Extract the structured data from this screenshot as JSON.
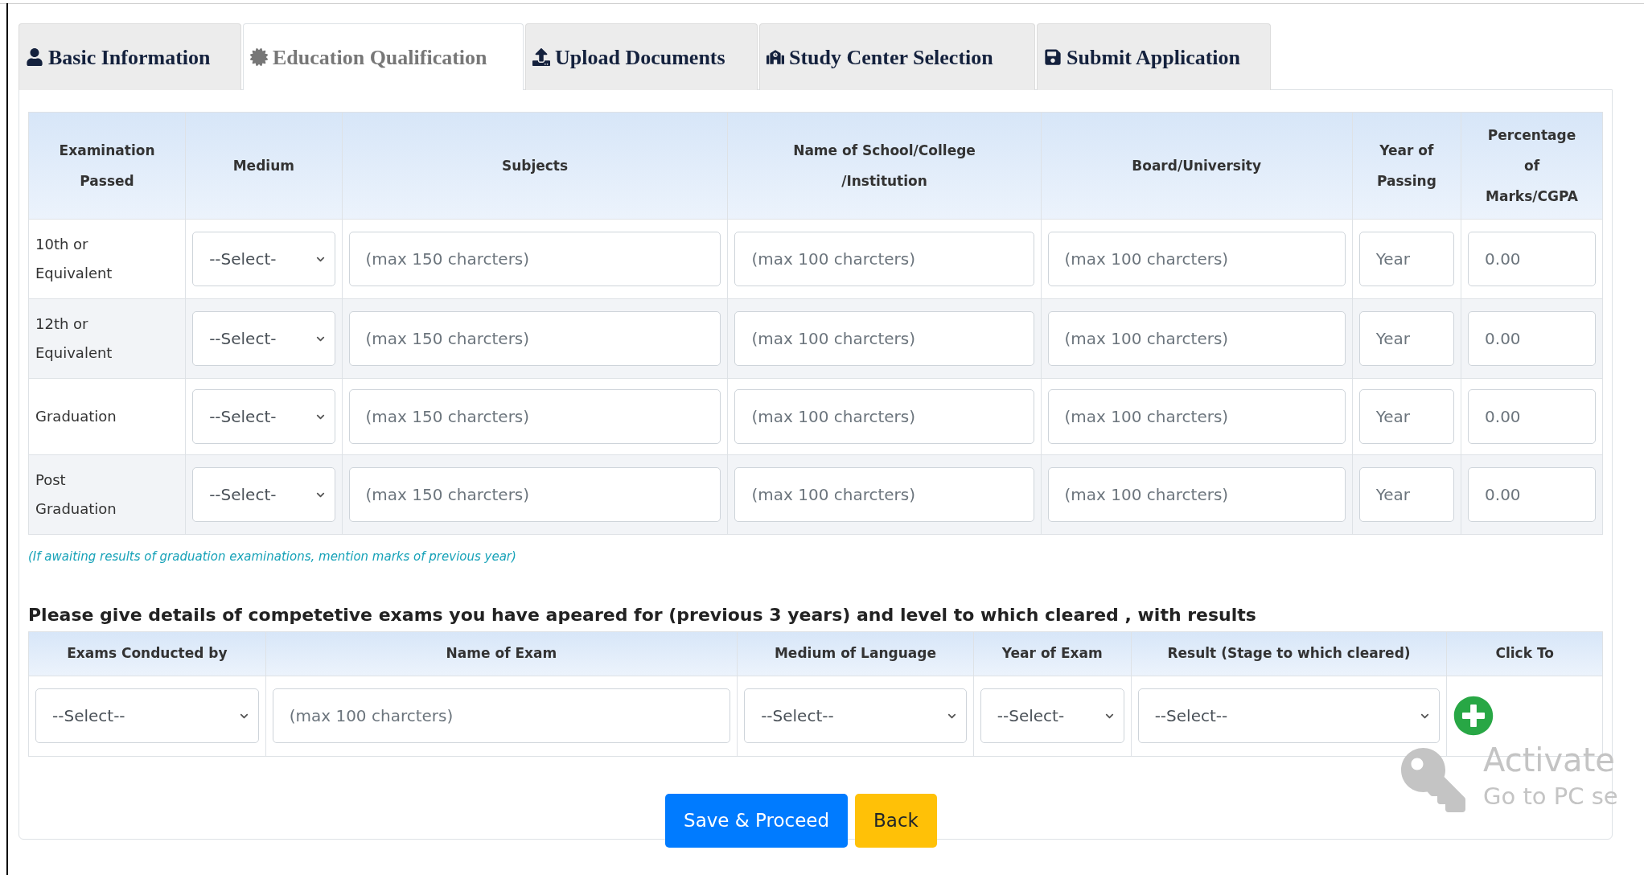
{
  "tabs": [
    {
      "label": "Basic Information",
      "selected": false
    },
    {
      "label": "Education Qualification",
      "selected": true
    },
    {
      "label": "Upload Documents",
      "selected": false
    },
    {
      "label": "Study Center Selection",
      "selected": false
    },
    {
      "label": "Submit Application",
      "selected": false
    }
  ],
  "education_table": {
    "columns": [
      "Examination Passed",
      "Medium",
      "Subjects",
      "Name of School/College /Institution",
      "Board/University",
      "Year of Passing",
      "Percentage of Marks/CGPA"
    ],
    "rows": [
      {
        "exam": "10th or Equivalent",
        "medium": "--Select-",
        "subjects": {
          "placeholder": "(max 150 charcters)"
        },
        "school": {
          "placeholder": "(max 100 charcters)"
        },
        "board": {
          "placeholder": "(max 100 charcters)"
        },
        "year": {
          "placeholder": "Year"
        },
        "percentage": {
          "placeholder": "0.00"
        }
      },
      {
        "exam": "12th or Equivalent",
        "medium": "--Select-",
        "subjects": {
          "placeholder": "(max 150 charcters)"
        },
        "school": {
          "placeholder": "(max 100 charcters)"
        },
        "board": {
          "placeholder": "(max 100 charcters)"
        },
        "year": {
          "placeholder": "Year"
        },
        "percentage": {
          "placeholder": "0.00"
        }
      },
      {
        "exam": "Graduation",
        "medium": "--Select-",
        "subjects": {
          "placeholder": "(max 150 charcters)"
        },
        "school": {
          "placeholder": "(max 100 charcters)"
        },
        "board": {
          "placeholder": "(max 100 charcters)"
        },
        "year": {
          "placeholder": "Year"
        },
        "percentage": {
          "placeholder": "0.00"
        }
      },
      {
        "exam": "Post Graduation",
        "medium": "--Select-",
        "subjects": {
          "placeholder": "(max 150 charcters)"
        },
        "school": {
          "placeholder": "(max 100 charcters)"
        },
        "board": {
          "placeholder": "(max 100 charcters)"
        },
        "year": {
          "placeholder": "Year"
        },
        "percentage": {
          "placeholder": "0.00"
        }
      }
    ]
  },
  "note": "(If awaiting results of graduation examinations, mention marks of previous year)",
  "competitive_heading": "Please give details of competetive exams you have apeared for (previous 3 years) and level to which cleared , with results",
  "exams_table": {
    "columns": [
      "Exams Conducted by",
      "Name of Exam",
      "Medium of Language",
      "Year of Exam",
      "Result (Stage to which cleared)",
      "Click To"
    ],
    "rows": [
      {
        "conducted_by": "--Select--",
        "name": {
          "placeholder": "(max 100 charcters)"
        },
        "medium": "--Select--",
        "year": "--Select-",
        "result": "--Select--"
      }
    ]
  },
  "buttons": [
    {
      "kind": "primary",
      "label": "Save & Proceed"
    },
    {
      "kind": "warning",
      "label": "Back"
    }
  ],
  "activation_notice": {
    "title": "Activate",
    "subtitle": "Go to PC se"
  }
}
